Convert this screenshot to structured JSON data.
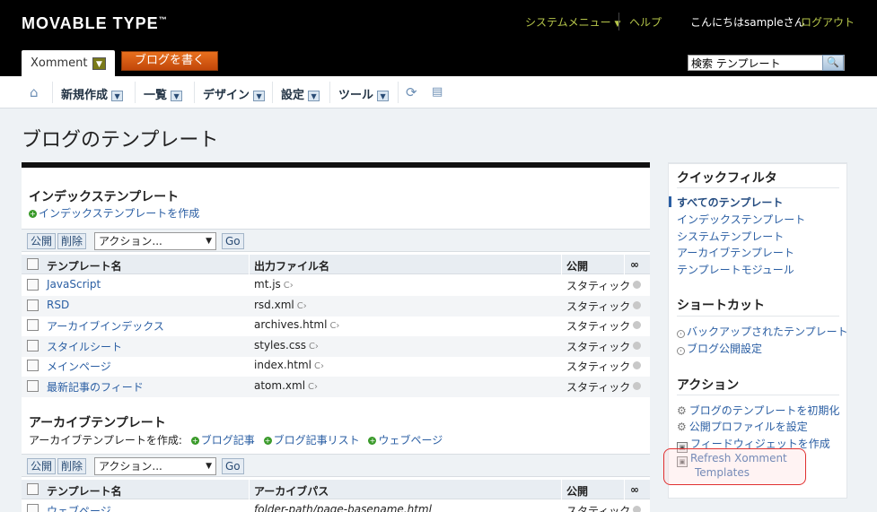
{
  "header": {
    "logo": "MOVABLE TYPE",
    "logo_tm": "™",
    "system_menu": "システムメニュー",
    "help": "ヘルプ",
    "greeting": "こんにちはsampleさん",
    "logout": "ログアウト",
    "blog_name": "Xomment",
    "write_button": "ブログを書く",
    "search_value": "検索 テンプレート"
  },
  "menu": {
    "items": [
      "新規作成",
      "一覧",
      "デザイン",
      "設定",
      "ツール"
    ]
  },
  "page_title": "ブログのテンプレート",
  "index_section": {
    "title": "インデックステンプレート",
    "create_link": "インデックステンプレートを作成",
    "publish_btn": "公開",
    "delete_btn": "削除",
    "action_select": "アクション...",
    "go_btn": "Go",
    "columns": [
      "テンプレート名",
      "出力ファイル名",
      "公開"
    ],
    "rows": [
      {
        "name": "JavaScript",
        "file": "mt.js",
        "publish": "スタティック"
      },
      {
        "name": "RSD",
        "file": "rsd.xml",
        "publish": "スタティック"
      },
      {
        "name": "アーカイブインデックス",
        "file": "archives.html",
        "publish": "スタティック"
      },
      {
        "name": "スタイルシート",
        "file": "styles.css",
        "publish": "スタティック"
      },
      {
        "name": "メインページ",
        "file": "index.html",
        "publish": "スタティック"
      },
      {
        "name": "最新記事のフィード",
        "file": "atom.xml",
        "publish": "スタティック"
      }
    ]
  },
  "archive_section": {
    "title": "アーカイブテンプレート",
    "create_label": "アーカイブテンプレートを作成:",
    "create_links": [
      "ブログ記事",
      "ブログ記事リスト",
      "ウェブページ"
    ],
    "publish_btn": "公開",
    "delete_btn": "削除",
    "action_select": "アクション...",
    "go_btn": "Go",
    "columns": [
      "テンプレート名",
      "アーカイブパス",
      "公開"
    ],
    "rows": [
      {
        "name": "ウェブページ",
        "path": "folder-path/page-basename.html",
        "publish": "スタティック"
      }
    ]
  },
  "sidebar": {
    "quick_filter_title": "クイックフィルタ",
    "filters": [
      "すべてのテンプレート",
      "インデックステンプレート",
      "システムテンプレート",
      "アーカイブテンプレート",
      "テンプレートモジュール"
    ],
    "shortcut_title": "ショートカット",
    "shortcuts": [
      "バックアップされたテンプレート",
      "ブログ公開設定"
    ],
    "action_title": "アクション",
    "actions": [
      "ブログのテンプレートを初期化",
      "公開プロファイルを設定",
      "フィードウィジェットを作成"
    ],
    "refresh_line1": "Refresh Xomment",
    "refresh_line2": "Templates"
  }
}
